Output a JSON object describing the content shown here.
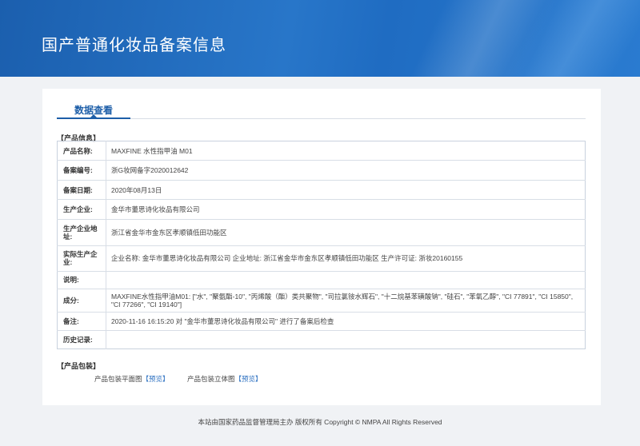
{
  "header": {
    "title": "国产普通化妆品备案信息"
  },
  "tab": {
    "label": "数据查看"
  },
  "product_info": {
    "section_title": "【产品信息】",
    "rows": [
      {
        "label": "产品名称:",
        "value": "MAXFINE 水性指甲油 M01"
      },
      {
        "label": "备案编号:",
        "value": "浙G妆网备字2020012642"
      },
      {
        "label": "备案日期:",
        "value": "2020年08月13日"
      },
      {
        "label": "生产企业:",
        "value": "金华市董思诗化妆品有限公司"
      },
      {
        "label": "生产企业地址:",
        "value": "浙江省金华市金东区孝顺镇低田功能区"
      },
      {
        "label": "实际生产企业:",
        "value": "企业名称: 金华市董思诗化妆品有限公司 企业地址: 浙江省金华市金东区孝顺镇低田功能区 生产许可证: 浙妆20160155"
      },
      {
        "label": "说明:",
        "value": ""
      },
      {
        "label": "成分:",
        "value": "MAXFINE水性指甲油M01: [\"水\", \"聚氨酯-10\", \"丙烯酸（酯）类共聚物\", \"司拉氯铵水辉石\", \"十二烷基苯磺酸钠\", \"硅石\", \"苯氧乙醇\", \"CI 77891\", \"CI 15850\", \"CI 77266\", \"CI 19140\"]"
      },
      {
        "label": "备注:",
        "value": "2020-11-16 16:15:20 对 \"金华市董思诗化妆品有限公司\" 进行了备案后检查"
      },
      {
        "label": "历史记录:",
        "value": ""
      }
    ]
  },
  "packaging": {
    "section_title": "【产品包装】",
    "items": [
      {
        "label": "产品包装平面图",
        "link": "【预览】"
      },
      {
        "label": "产品包装立体图",
        "link": "【预览】"
      }
    ]
  },
  "footer": {
    "text": "本站由国家药品监督管理局主办 版权所有 Copyright © NMPA All Rights Reserved"
  }
}
